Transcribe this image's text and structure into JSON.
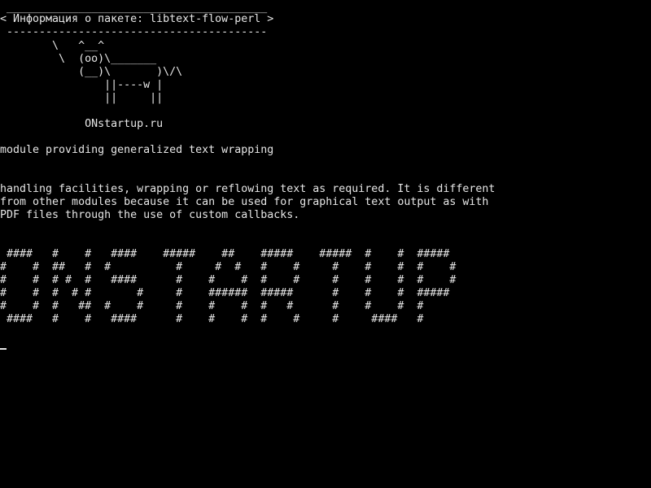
{
  "terminal": {
    "banner": {
      "top_border": " ________________________________________",
      "title": "< Информация о пакете: libtext-flow-perl >",
      "bottom_border": " ----------------------------------------"
    },
    "cow": [
      "        \\   ^__^",
      "         \\  (oo)\\_______",
      "            (__)\\       )\\/\\",
      "                ||----w |",
      "                ||     ||"
    ],
    "site": "             ONstartup.ru",
    "summary": "module providing generalized text wrapping",
    "description": [
      "handling facilities, wrapping or reflowing text as required. It is different",
      "from other modules because it can be used for graphical text output as with",
      "PDF files through the use of custom callbacks."
    ],
    "big_text": [
      " ####   #    #   ####    #####    ##    #####    #####  #    #  #####",
      "#    #  ##   #  #          #     #  #   #    #     #    #    #  #    #",
      "#    #  # #  #   ####      #    #    #  #    #     #    #    #  #    #",
      "#    #  #  # #       #     #    ######  #####      #    #    #  #####",
      "#    #  #   ##  #    #     #    #    #  #   #      #    #    #  #",
      " ####   #    #   ####      #    #    #  #    #     #     ####   #"
    ],
    "colors": {
      "background": "#000000",
      "foreground": "#e6e6e6"
    }
  }
}
